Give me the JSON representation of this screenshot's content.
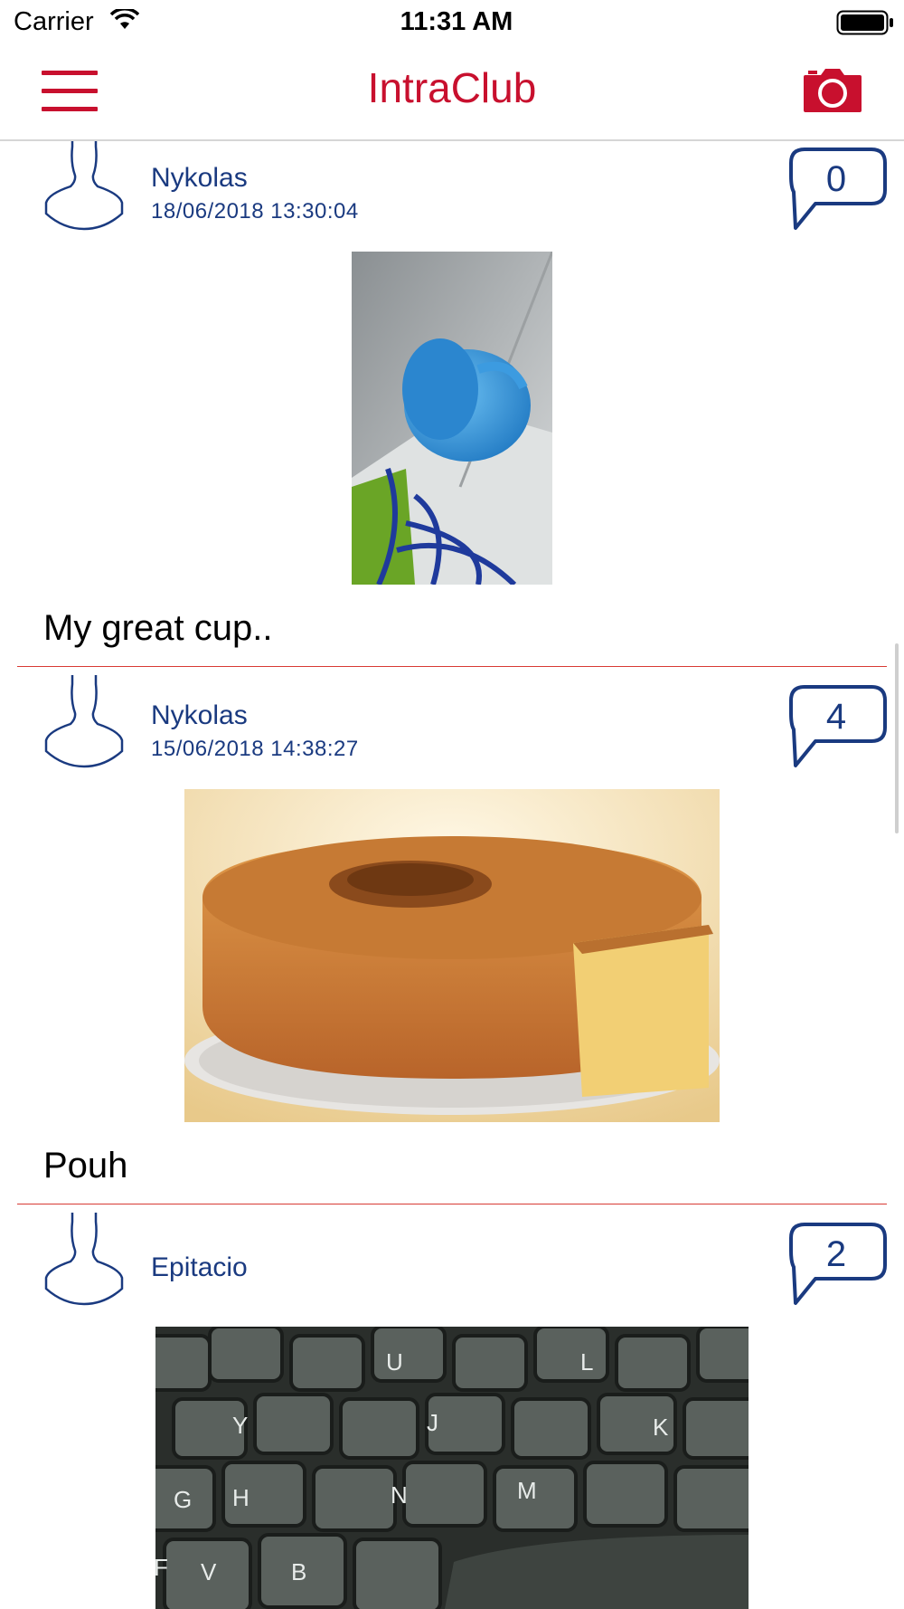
{
  "status_bar": {
    "carrier": "Carrier",
    "time": "11:31 AM"
  },
  "navbar": {
    "title": "IntraClub",
    "menu_icon": "hamburger-menu-icon",
    "camera_icon": "camera-icon"
  },
  "colors": {
    "brand_red": "#c8102e",
    "text_blue": "#1a3a80",
    "divider": "#d83a34"
  },
  "posts": [
    {
      "author": "Nykolas",
      "timestamp": "18/06/2018 13:30:04",
      "comments": "0",
      "caption": "My great cup..",
      "photo": "blue cup on desk with cables"
    },
    {
      "author": "Nykolas",
      "timestamp": "15/06/2018 14:38:27",
      "comments": "4",
      "caption": "Pouh",
      "photo": "sponge bundt cake on plate"
    },
    {
      "author": "Epitacio",
      "timestamp": "",
      "comments": "2",
      "caption": "",
      "photo": "keyboard keys close-up"
    }
  ]
}
